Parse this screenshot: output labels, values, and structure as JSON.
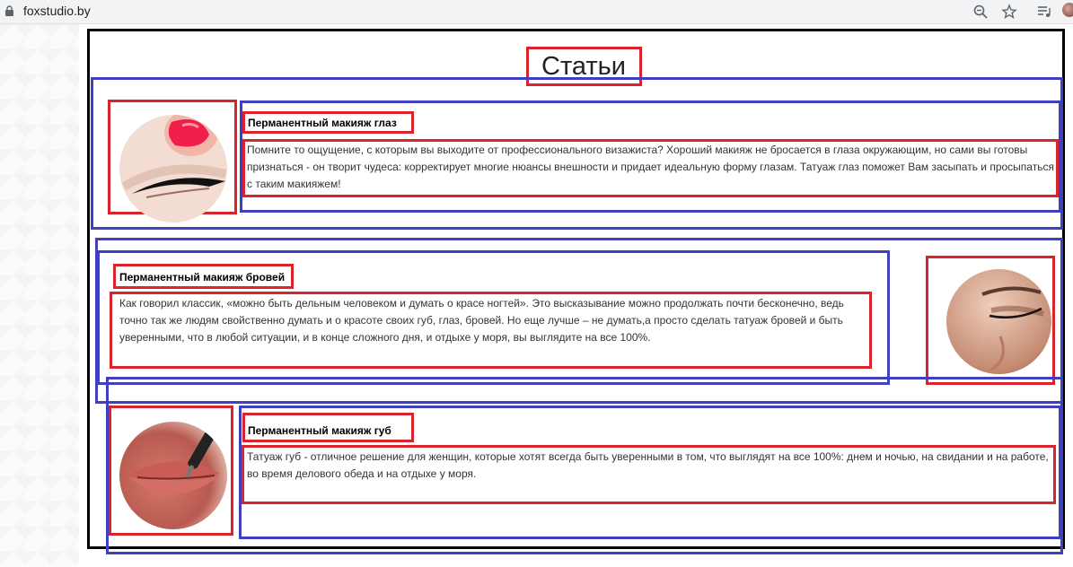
{
  "browser": {
    "url": "foxstudio.by"
  },
  "page": {
    "title": "Статьи",
    "articles": [
      {
        "heading": "Перманентный макияж глаз",
        "text": "Помните то ощущение, с которым вы выходите от профессионального визажиста? Хороший макияж не бросается в глаза окружающим, но сами вы готовы признаться - он творит чудеса: корректирует многие нюансы внешности и придает идеальную форму глазам. Татуаж глаз поможет Вам засыпать и просыпаться с таким макияжем!"
      },
      {
        "heading": "Перманентный макияж бровей",
        "text": "Как говорил классик, «можно быть дельным человеком и думать о красе ногтей». Это высказывание можно продолжать почти бесконечно, ведь точно так же людям свойственно думать и о красоте своих губ, глаз, бровей. Но еще лучше – не думать,а просто сделать татуаж бровей и быть уверенными, что в любой ситуации, и в конце сложного дня, и отдыхе у моря, вы выглядите на все 100%."
      },
      {
        "heading": "Перманентный макияж губ",
        "text": "Татуаж губ - отличное решение для женщин, которые хотят всегда быть уверенными в том, что выглядят на все 100%: днем и ночью, на свидании и на работе, во время делового обеда и на отдыхе у моря."
      }
    ]
  },
  "colors": {
    "outline_black": "#000000",
    "outline_blue": "#3f3fbf",
    "outline_red": "#d9232d"
  },
  "icons": [
    "lock-icon",
    "zoom-icon",
    "star-icon",
    "media-queue-icon",
    "avatar"
  ]
}
